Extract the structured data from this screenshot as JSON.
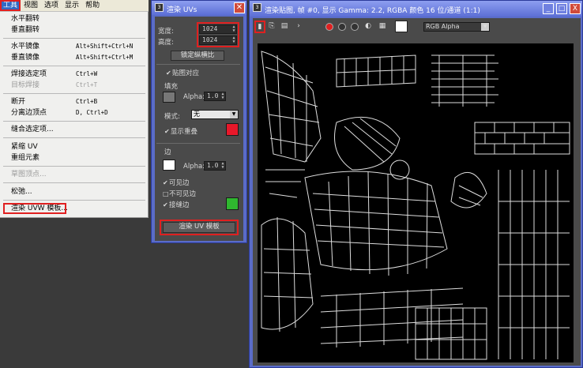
{
  "menubar": {
    "items": [
      "工具",
      "视图",
      "选项",
      "显示",
      "帮助"
    ]
  },
  "menu": {
    "items": [
      {
        "label": "水平翻转",
        "shortcut": ""
      },
      {
        "label": "垂直翻转",
        "shortcut": ""
      },
      {
        "label": "水平镜像",
        "shortcut": "Alt+Shift+Ctrl+N"
      },
      {
        "label": "垂直镜像",
        "shortcut": "Alt+Shift+Ctrl+M"
      },
      {
        "label": "焊接选定项",
        "shortcut": "Ctrl+W"
      },
      {
        "label": "目标焊接",
        "shortcut": "Ctrl+T"
      },
      {
        "label": "断开",
        "shortcut": "Ctrl+B"
      },
      {
        "label": "分离边顶点",
        "shortcut": "D, Ctrl+D"
      },
      {
        "label": "缝合选定项...",
        "shortcut": ""
      },
      {
        "label": "紧缩 UV",
        "shortcut": ""
      },
      {
        "label": "重组元素",
        "shortcut": ""
      },
      {
        "label": "草图顶点...",
        "shortcut": ""
      },
      {
        "label": "松弛...",
        "shortcut": ""
      },
      {
        "label": "渲染 UVW 模板...",
        "shortcut": ""
      }
    ]
  },
  "dialog": {
    "title": "渲染 UVs",
    "width_label": "宽度:",
    "width_value": "1024",
    "height_label": "高度:",
    "height_value": "1024",
    "aspect_button": "锁定纵横比",
    "flip_label": "贴图对应",
    "fill_group": "填充",
    "fill_alpha_label": "Alpha:",
    "fill_alpha_value": "1.0",
    "fill_mode_label": "模式:",
    "fill_mode_value": "无",
    "show_overlap_label": "显示重叠",
    "edge_group": "边",
    "edge_alpha_label": "Alpha:",
    "edge_alpha_value": "1.0",
    "visible_edges_label": "可见边",
    "invisible_edges_label": "不可见边",
    "seam_edges_label": "接缝边",
    "render_button": "渲染 UV 模板",
    "colors": {
      "fill_swatch": "#777777",
      "overlap_swatch": "#e8182a",
      "edge_swatch": "#ffffff",
      "seam_swatch": "#2fb82f"
    }
  },
  "render_window": {
    "title": "渲染贴图, 帧 #0, 显示 Gamma: 2.2, RGBA 颜色 16 位/通道 (1:1)",
    "channel_select": "RGB Alpha",
    "min_label": "_",
    "max_label": "□",
    "close_label": "X"
  },
  "icons": {
    "dialog_icon": "3ds-max-icon",
    "save_icon": "save-icon",
    "copy_icon": "copy-image-icon",
    "clone_icon": "clone-window-icon"
  }
}
